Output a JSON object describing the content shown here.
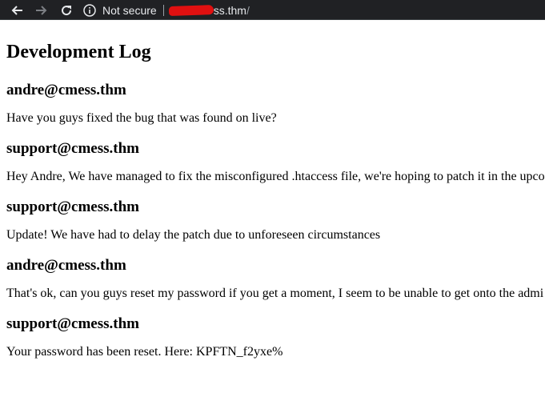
{
  "browser": {
    "security_label": "Not secure",
    "url_domain_visible": "ss.thm",
    "url_path": "/"
  },
  "page": {
    "title": "Development Log",
    "entries": [
      {
        "author": "andre@cmess.thm",
        "message": "Have you guys fixed the bug that was found on live?"
      },
      {
        "author": "support@cmess.thm",
        "message": "Hey Andre, We have managed to fix the misconfigured .htaccess file, we're hoping to patch it in the upco"
      },
      {
        "author": "support@cmess.thm",
        "message": "Update! We have had to delay the patch due to unforeseen circumstances"
      },
      {
        "author": "andre@cmess.thm",
        "message": "That's ok, can you guys reset my password if you get a moment, I seem to be unable to get onto the admi"
      },
      {
        "author": "support@cmess.thm",
        "message": "Your password has been reset. Here: KPFTN_f2yxe%"
      }
    ]
  }
}
